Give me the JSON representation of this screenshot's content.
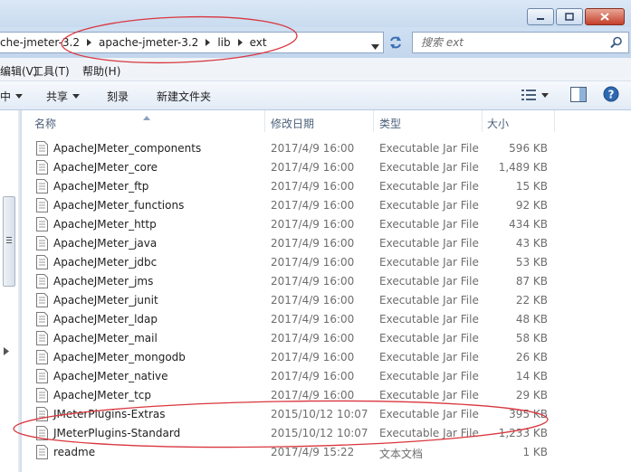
{
  "titlebar": {
    "buttons": [
      "minimize-icon",
      "maximize-icon",
      "close-icon"
    ]
  },
  "address": {
    "crumbs": [
      "che-jmeter-3.2",
      "apache-jmeter-3.2",
      "lib",
      "ext"
    ],
    "search_placeholder": "搜索 ext"
  },
  "menu": {
    "items": [
      "编辑(V)",
      "工具(T)",
      "帮助(H)"
    ]
  },
  "toolbar": {
    "items": [
      "中",
      "共享",
      "刻录",
      "新建文件夹"
    ],
    "icons": [
      "view-options-icon",
      "preview-pane-icon",
      "help-icon"
    ]
  },
  "columns": {
    "name": "名称",
    "date": "修改日期",
    "type": "类型",
    "size": "大小"
  },
  "files": [
    {
      "name": "ApacheJMeter_components",
      "date": "2017/4/9 16:00",
      "type": "Executable Jar File",
      "size": "596 KB"
    },
    {
      "name": "ApacheJMeter_core",
      "date": "2017/4/9 16:00",
      "type": "Executable Jar File",
      "size": "1,489 KB"
    },
    {
      "name": "ApacheJMeter_ftp",
      "date": "2017/4/9 16:00",
      "type": "Executable Jar File",
      "size": "15 KB"
    },
    {
      "name": "ApacheJMeter_functions",
      "date": "2017/4/9 16:00",
      "type": "Executable Jar File",
      "size": "92 KB"
    },
    {
      "name": "ApacheJMeter_http",
      "date": "2017/4/9 16:00",
      "type": "Executable Jar File",
      "size": "434 KB"
    },
    {
      "name": "ApacheJMeter_java",
      "date": "2017/4/9 16:00",
      "type": "Executable Jar File",
      "size": "43 KB"
    },
    {
      "name": "ApacheJMeter_jdbc",
      "date": "2017/4/9 16:00",
      "type": "Executable Jar File",
      "size": "53 KB"
    },
    {
      "name": "ApacheJMeter_jms",
      "date": "2017/4/9 16:00",
      "type": "Executable Jar File",
      "size": "87 KB"
    },
    {
      "name": "ApacheJMeter_junit",
      "date": "2017/4/9 16:00",
      "type": "Executable Jar File",
      "size": "22 KB"
    },
    {
      "name": "ApacheJMeter_ldap",
      "date": "2017/4/9 16:00",
      "type": "Executable Jar File",
      "size": "48 KB"
    },
    {
      "name": "ApacheJMeter_mail",
      "date": "2017/4/9 16:00",
      "type": "Executable Jar File",
      "size": "58 KB"
    },
    {
      "name": "ApacheJMeter_mongodb",
      "date": "2017/4/9 16:00",
      "type": "Executable Jar File",
      "size": "26 KB"
    },
    {
      "name": "ApacheJMeter_native",
      "date": "2017/4/9 16:00",
      "type": "Executable Jar File",
      "size": "14 KB"
    },
    {
      "name": "ApacheJMeter_tcp",
      "date": "2017/4/9 16:00",
      "type": "Executable Jar File",
      "size": "29 KB"
    },
    {
      "name": "JMeterPlugins-Extras",
      "date": "2015/10/12 10:07",
      "type": "Executable Jar File",
      "size": "395 KB"
    },
    {
      "name": "JMeterPlugins-Standard",
      "date": "2015/10/12 10:07",
      "type": "Executable Jar File",
      "size": "1,233 KB"
    },
    {
      "name": "readme",
      "date": "2017/4/9 15:22",
      "type": "文本文档",
      "size": "1 KB"
    }
  ],
  "colors": {
    "annotation": "#d9363e",
    "header_text": "#4c607a",
    "meta_text": "#6d6d6d"
  }
}
